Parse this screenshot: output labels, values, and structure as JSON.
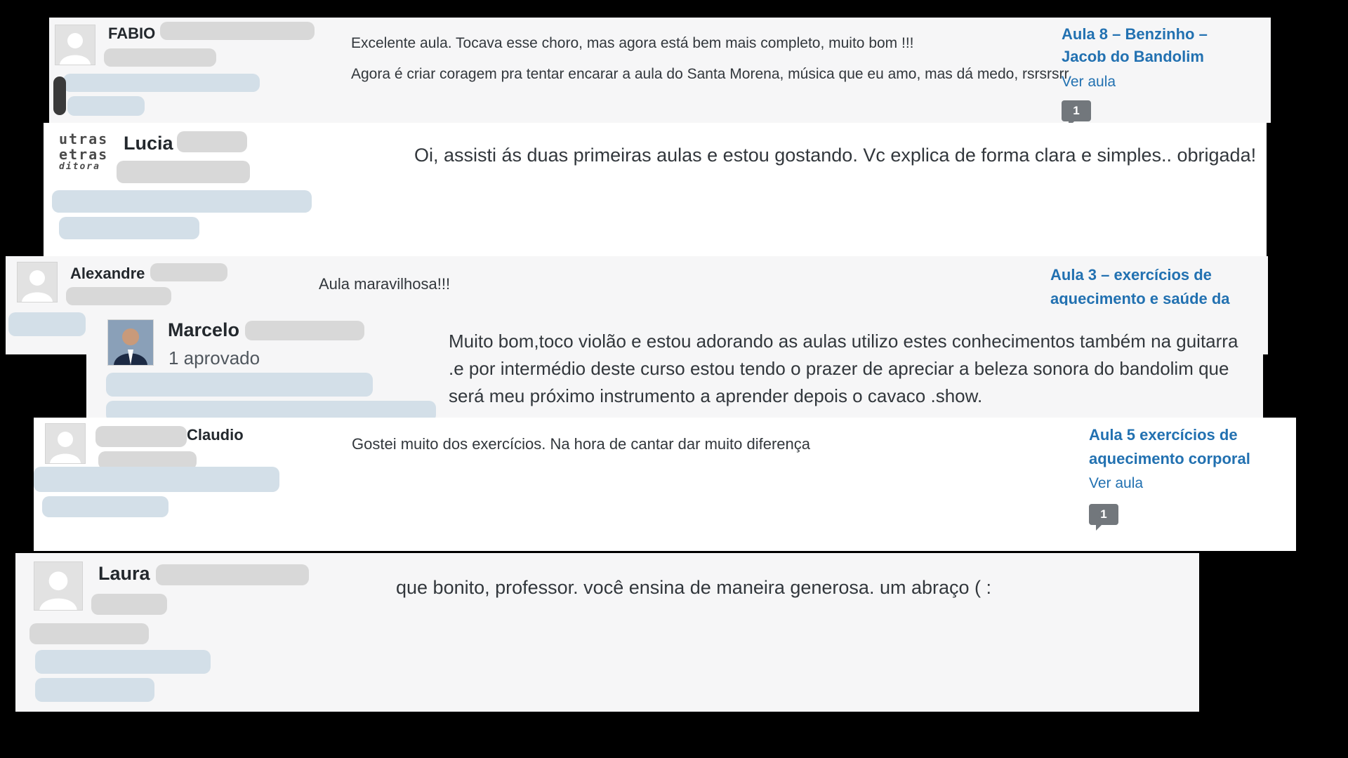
{
  "comments": [
    {
      "author": "FABIO",
      "text": [
        "Excelente aula. Tocava esse choro, mas agora está bem mais completo, muito bom !!!",
        "Agora é criar coragem pra tentar encarar a aula do Santa Morena, música que eu amo, mas dá medo, rsrsrsrr"
      ],
      "post_title": "Aula 8 – Benzinho – Jacob do Bandolim",
      "view_link": "Ver aula",
      "count": "1"
    },
    {
      "author": "Lucia",
      "logo_lines": [
        "utras",
        "etras",
        "ditora"
      ],
      "text": "Oi, assisti ás duas primeiras aulas e estou gostando. Vc explica de forma clara e simples.. obrigada!"
    },
    {
      "author": "Alexandre",
      "text": "Aula maravilhosa!!!",
      "post_title": "Aula 3 – exercícios de aquecimento e saúde da"
    },
    {
      "author": "Marcelo",
      "badge": "1 aprovado",
      "text": "Muito bom,toco violão e estou adorando as aulas utilizo estes conhecimentos também na guitarra .e por intermédio deste curso estou tendo o prazer de apreciar a beleza sonora do bandolim que será meu próximo instrumento a aprender depois o cavaco .show."
    },
    {
      "author": "Claudio",
      "text": "Gostei muito dos exercícios. Na hora de cantar dar muito diferença",
      "post_title": "Aula 5 exercícios de aquecimento corporal",
      "view_link": "Ver aula",
      "count": "1"
    },
    {
      "author": "Laura",
      "text": "que bonito, professor. você ensina de maneira generosa. um abraço ( :"
    }
  ],
  "colors": {
    "background": "#000000",
    "card": "#f6f6f7",
    "link": "#2271b1",
    "bubble": "#72777c"
  }
}
